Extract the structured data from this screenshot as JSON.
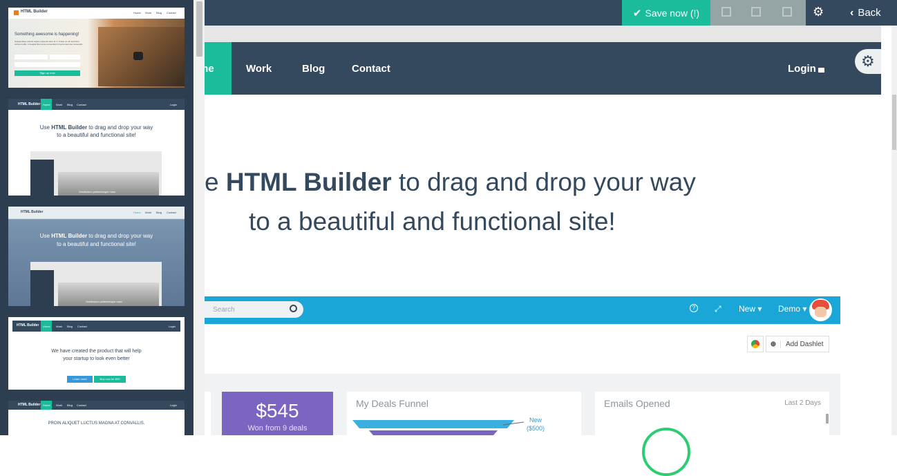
{
  "toolbar": {
    "save_label": "Save now (!)",
    "back_label": "Back",
    "icons": [
      "duplicate-icon",
      "window-icon",
      "export-icon",
      "gear-icon"
    ]
  },
  "page_nav": {
    "items": [
      "me",
      "Work",
      "Blog",
      "Contact"
    ],
    "login_label": "Login"
  },
  "hero": {
    "line1_prefix": "e ",
    "line1_bold": "HTML Builder",
    "line1_suffix": " to drag and drop your way",
    "line2": "to a beautiful and functional site!"
  },
  "app_preview": {
    "search_placeholder": "Search",
    "new_label": "New",
    "user_label": "Demo",
    "add_dashlet_label": "Add Dashlet",
    "cards": {
      "price_value": "$545",
      "price_caption": "Won from 9 deals",
      "funnel_title": "My Deals Funnel",
      "funnel_label_line1": "New",
      "funnel_label_line2": "($500)",
      "emails_title": "Emails Opened",
      "emails_range": "Last 2 Days"
    }
  },
  "thumbnails": {
    "t1": {
      "brand": "HTML Builder",
      "nav": [
        "Home",
        "Work",
        "Blog",
        "Contact"
      ],
      "heading": "Something awesome is happening!",
      "body": "Suspendisse potenti sapien placerat tortor id in. Fusce ac elit sed risus cursus mollis. In feugiat liber amet consectetur id accumsan leo venenatis.",
      "cta": "Sign up now"
    },
    "t2": {
      "brand": "HTML Builder",
      "nav": [
        "Home",
        "Work",
        "Blog",
        "Contact"
      ],
      "login": "Login",
      "line1_prefix": "Use ",
      "line1_bold": "HTML Builder",
      "line1_suffix": " to drag and drop your way",
      "line2": "to a beautiful and functional site!",
      "caption": "Vestibulum pellentesque nunc"
    },
    "t3": {
      "brand": "HTML Builder",
      "nav": [
        "Home",
        "Work",
        "Blog",
        "Contact"
      ],
      "line1_prefix": "Use ",
      "line1_bold": "HTML Builder",
      "line1_suffix": " to drag and drop your way",
      "line2": "to a beautiful and functional site!",
      "caption": "Vestibulum pellentesque nunc"
    },
    "t4": {
      "brand": "HTML Builder",
      "nav": [
        "Home",
        "Work",
        "Blog",
        "Contact"
      ],
      "login": "Login",
      "line1": "We have created the product that will help",
      "line2": "your startup to look even better",
      "btn1": "Learn more",
      "btn2": "Buy now for $99"
    },
    "t5": {
      "brand": "HTML Builder",
      "nav": [
        "Home",
        "Work",
        "Blog",
        "Contact"
      ],
      "login": "Login",
      "heading": "PROIN ALIQUET LUCTUS MAGNA AT CONVALLIS."
    }
  },
  "colors": {
    "toolbar": "#34495e",
    "accent": "#1abc9c",
    "grey_tools": "#95a5a6",
    "app_bar": "#1aa7d8",
    "price_card": "#7c65c0"
  }
}
